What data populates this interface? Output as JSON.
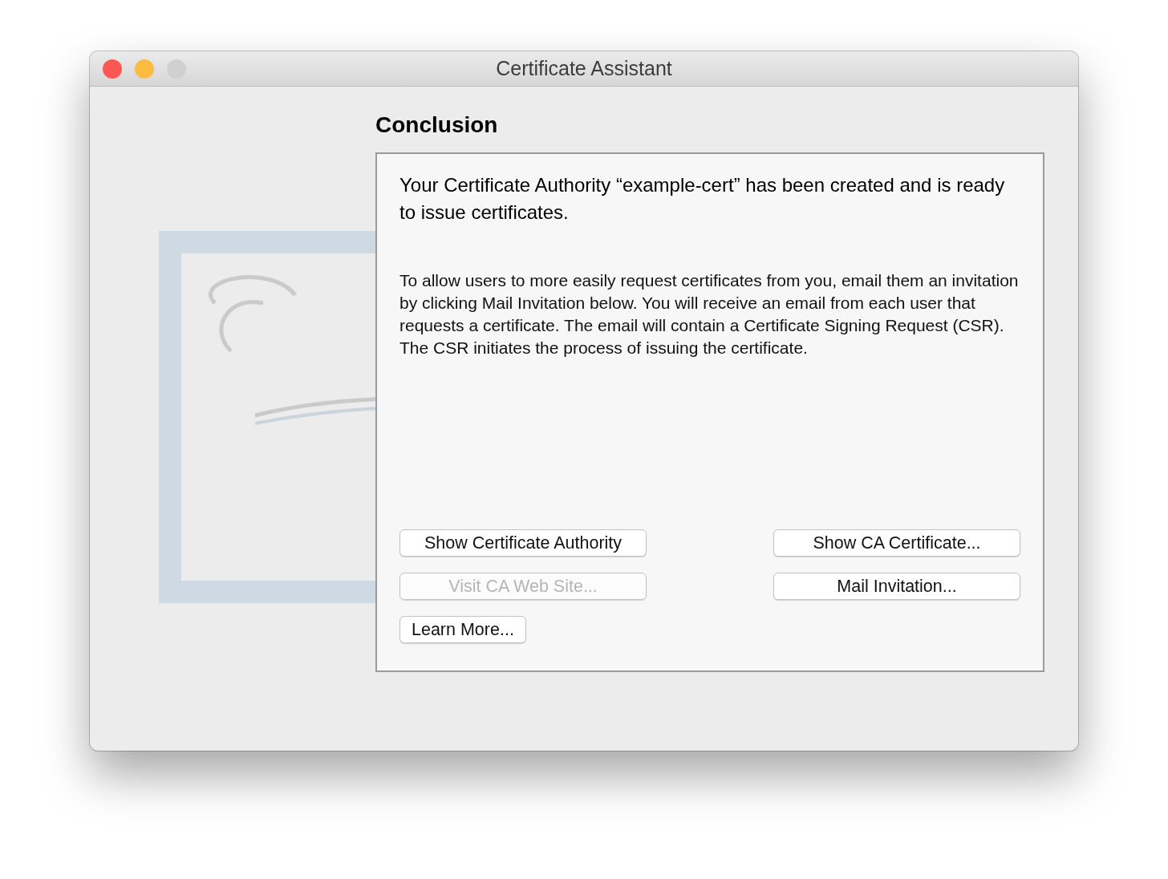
{
  "window": {
    "title": "Certificate Assistant",
    "traffic_lights": [
      {
        "color": "#fc5753"
      },
      {
        "color": "#fdbc40"
      },
      {
        "color": "#d0d0d0"
      }
    ]
  },
  "heading": "Conclusion",
  "message": "Your Certificate Authority “example-cert” has been created and is ready to issue certificates.",
  "description": "To allow users to more easily request certificates from you, email them an invitation by clicking Mail Invitation below. You will receive an email from each user that requests a certificate. The email will contain a Certificate Signing Request (CSR). The CSR initiates the process of issuing the certificate.",
  "left_buttons": [
    {
      "label": "Show Certificate Authority",
      "wide": true,
      "disabled": false
    },
    {
      "label": "Visit CA Web Site...",
      "wide": true,
      "disabled": true
    },
    {
      "label": "Learn More...",
      "wide": false,
      "disabled": false
    }
  ],
  "right_buttons": [
    {
      "label": "Show CA Certificate...",
      "wide": true,
      "disabled": false
    },
    {
      "label": "Mail Invitation...",
      "wide": true,
      "disabled": false
    }
  ]
}
